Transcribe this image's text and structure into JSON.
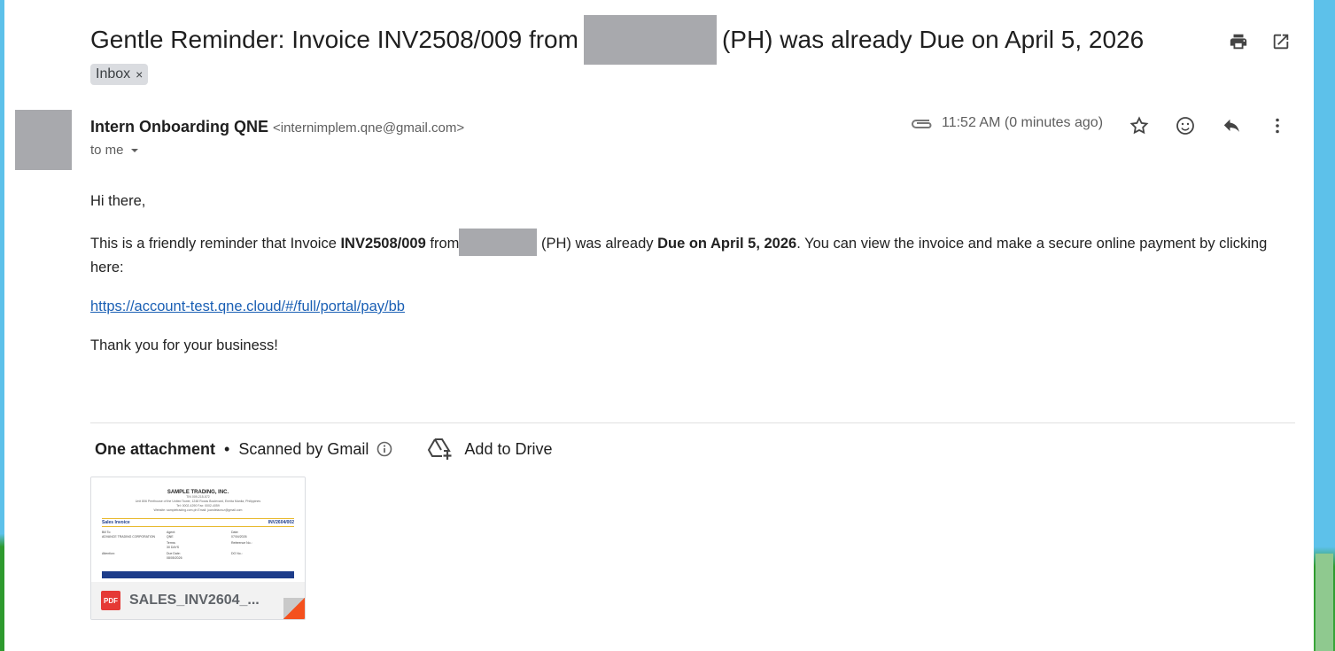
{
  "subject": {
    "prefix": "Gentle Reminder: Invoice INV2508/009 from",
    "suffix": "(PH) was already Due on April 5, 2026",
    "label_chip": "Inbox",
    "chip_close": "×"
  },
  "toolbar": {
    "print_icon": "print-icon",
    "open_new_window_icon": "open-in-new-window-icon"
  },
  "sender": {
    "name": "Intern Onboarding QNE",
    "email": "<internimplem.qne@gmail.com>",
    "to": "to me",
    "time": "11:52 AM (0 minutes ago)"
  },
  "message": {
    "greeting": "Hi there,",
    "line_a": "This is a friendly reminder that Invoice ",
    "invoice": "INV2508/009",
    "from_word": " from",
    "after_redact": " (PH) was already ",
    "due": "Due on April 5, 2026",
    "line_b": ". You can view the invoice and make a secure online payment by clicking here:",
    "link": "https://account-test.qne.cloud/#/full/portal/pay/bb",
    "closing": "Thank you for your business!"
  },
  "attachments": {
    "count_label": "One attachment",
    "separator": "•",
    "scanned": "Scanned by Gmail",
    "add_to_drive": "Add to Drive",
    "file_name": "SALES_INV2604_...",
    "file_type": "PDF"
  },
  "thumbnail": {
    "company": "SAMPLE TRADING, INC.",
    "address_1": "TIN 009-215-572",
    "address_2": "Unit 806 Penthouse of the United Tower, 1248 Roxas Boulevard, Ermita Manila, Philippines",
    "address_3": "Tel: 0002-4290  Fax: 0002-4059",
    "address_4": "Website: sampletrading.com.ph  Email: juandelacruz@gmail.com",
    "doc_title": "Sales Invoice",
    "doc_no": "INV2604/002",
    "bill_to": "Bill To:",
    "customer": "ADVANCE TRADING CORPORATION",
    "agent": "Agent:",
    "agent_val": "QNE",
    "date": "Date:",
    "date_val": "07/04/2026",
    "terms": "Terms:",
    "terms_val": "30 DAYS",
    "ref": "Reference No.:",
    "attention": "Attention:",
    "due_date": "Due Date:",
    "due_val": "08/05/2026",
    "do_no": "DO No.:"
  }
}
